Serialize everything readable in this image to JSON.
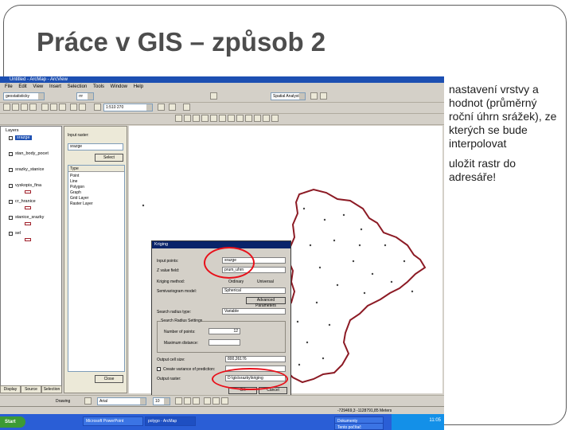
{
  "slide": {
    "title": "Práce v GIS – způsob 2",
    "bullets": [
      "nastavení vrstvy a hodnot (průměrný roční úhrn srážek), ze kterých se bude interpolovat",
      "uložit rastr do adresáře!"
    ]
  },
  "screenshot": {
    "app": {
      "title": "Untitled - ArcMap - ArcView",
      "menu": [
        "File",
        "Edit",
        "View",
        "Insert",
        "Selection",
        "Tools",
        "Window",
        "Help"
      ]
    },
    "toolbar": {
      "scale_value": "1:510 270",
      "georef_layer": "geostatisticky",
      "layer_combo": "rrr",
      "spatial_combo": "Spatial Analyst"
    },
    "toc": {
      "root": "Layers",
      "layers": [
        "srazge",
        "stan_body_pocet",
        "srazky_stanice",
        "vyskopis_fina",
        "cr_hranice",
        "stanice_srazky",
        "sel"
      ],
      "tabs": [
        "Display",
        "Source",
        "Selection"
      ]
    },
    "side_panel": {
      "label": "Input raster:",
      "selected": "srazge",
      "button": "Select",
      "list_header": "Type",
      "list_items": [
        "Point",
        "Line",
        "Polygon",
        "Graph",
        "Grid Layer",
        "Raster Layer"
      ],
      "close_button": "Close"
    },
    "dialog": {
      "title": "Kriging",
      "input_points_label": "Input points:",
      "input_points_value": "srazge",
      "z_field_label": "Z value field:",
      "z_field_value": "prum_uhrn",
      "method_label": "Kriging method:",
      "method_option_1": "Ordinary",
      "method_option_2": "Universal",
      "semivariogram_label": "Semivariogram model:",
      "semivariogram_value": "Spherical",
      "advanced_button": "Advanced Parameters",
      "search_label": "Search radius type:",
      "search_value": "Variable",
      "group_label": "Search Radius Settings",
      "npoints_label": "Number of points:",
      "npoints_value": "12",
      "maxdist_label": "Maximum distance:",
      "cellsize_label": "Output cell size:",
      "cellsize_value": "800,26176",
      "variance_label": "Create variance of prediction:",
      "output_label": "Output raster:",
      "output_value": "D:\\gis\\srazky\\kriging",
      "ok_button": "OK",
      "cancel_button": "Cancel"
    },
    "drawing_toolbar": {
      "drawing_label": "Drawing",
      "font": "Arial",
      "font_size": "10"
    },
    "status_bar": {
      "coords": "-729469,3  -1128791,85 Meters"
    },
    "taskbar": {
      "start_label": "Start",
      "tasks": [
        "Microsoft PowerPoint",
        "polygo - ArcMap",
        "Dokumenty",
        "Tento počítač"
      ],
      "clock": "11:05"
    }
  }
}
